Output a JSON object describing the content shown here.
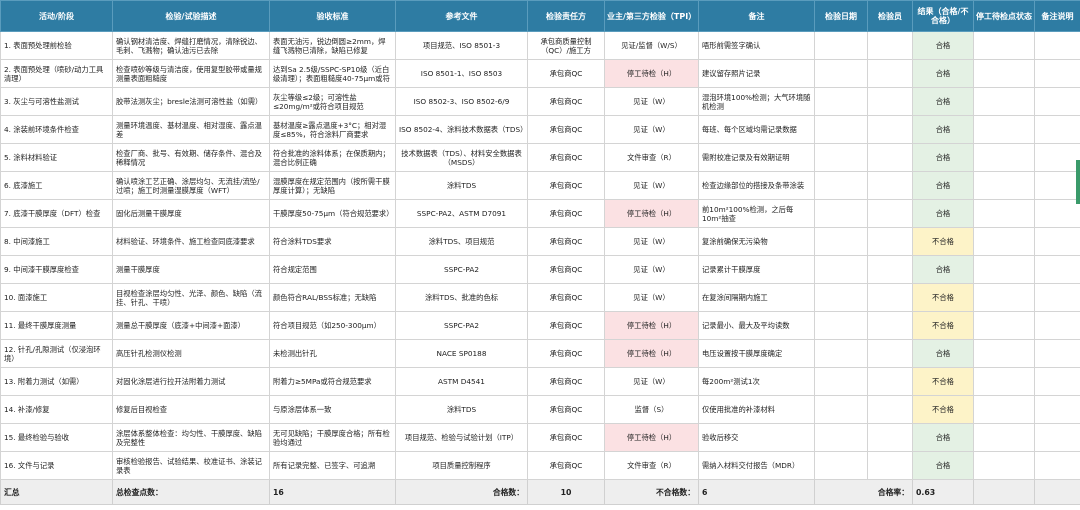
{
  "headers": [
    "活动/阶段",
    "检验/试验描述",
    "验收标准",
    "参考文件",
    "检验责任方",
    "业主/第三方检验（TPI）",
    "备注",
    "检验日期",
    "检验员",
    "结果（合格/不合格）",
    "停工待检点状态",
    "备注说明"
  ],
  "rows": [
    {
      "activity": "1. 表面预处理前检验",
      "desc": "确认钢材清洁度、焊缝打磨情况，清除锐边、毛刺、飞溅物；确认油污已去除",
      "criteria": "表面无油污，锐边倒圆≥2mm，焊缝飞溅物已清除，缺陷已修复",
      "ref": "项目规范、ISO 8501-3",
      "resp": "承包商质量控制（QC）/施工方",
      "tpi": "见证/监督（W/S）",
      "tpi_stop": false,
      "note": "唔形前需签字确认",
      "result": "合格",
      "pass": true
    },
    {
      "activity": "2. 表面预处理（喷砂/动力工具清理）",
      "desc": "检查喷砂等级与清洁度，使用复型胶带或量规测量表面粗糙度",
      "criteria": "达到Sa 2.5级/SSPC-SP10级（近白级清理）；表面粗糙度40-75μm或符合规范要求",
      "ref": "ISO 8501-1、ISO 8503",
      "resp": "承包商QC",
      "tpi": "停工待检（H）",
      "tpi_stop": true,
      "note": "建议留存照片记录",
      "result": "合格",
      "pass": true
    },
    {
      "activity": "3. 灰尘与可溶性盐测试",
      "desc": "胶带法测灰尘；bresle法测可溶性盐（如需）",
      "criteria": "灰尘等级≤2级；可溶性盐≤20mg/m²或符合项目规范",
      "ref": "ISO 8502-3、ISO 8502-6/9",
      "resp": "承包商QC",
      "tpi": "见证（W）",
      "tpi_stop": false,
      "note": "湿泡环境100%检测；大气环境随机检测",
      "result": "合格",
      "pass": true
    },
    {
      "activity": "4. 涂装前环境条件检查",
      "desc": "测量环境温度、基材温度、相对湿度、露点温差",
      "criteria": "基材温度≥露点温度+3°C；相对湿度≤85%，符合涂料厂商要求",
      "ref": "ISO 8502-4、涂料技术数据表（TDS）",
      "resp": "承包商QC",
      "tpi": "见证（W）",
      "tpi_stop": false,
      "note": "每班、每个区域均需记录数据",
      "result": "合格",
      "pass": true
    },
    {
      "activity": "5. 涂料材料验证",
      "desc": "检查厂商、批号、有效期、储存条件、混合及稀释情况",
      "criteria": "符合批准的涂料体系；在保质期内；混合比例正确",
      "ref": "技术数据表（TDS）、材料安全数据表（MSDS）",
      "resp": "承包商QC",
      "tpi": "文件审查（R）",
      "tpi_stop": false,
      "note": "需附校准记录及有效期证明",
      "result": "合格",
      "pass": true
    },
    {
      "activity": "6. 底漆施工",
      "desc": "确认喷涂工艺正确、涂层均匀、无流挂/流坠/过喷；施工时测量湿膜厚度（WFT）",
      "criteria": "湿膜厚度在规定范围内（按所需干膜厚度计算）；无缺陷",
      "ref": "涂料TDS",
      "resp": "承包商QC",
      "tpi": "见证（W）",
      "tpi_stop": false,
      "note": "检查边缘部位的搭接及条带涂装",
      "result": "合格",
      "pass": true
    },
    {
      "activity": "7. 底漆干膜厚度（DFT）检查",
      "desc": "固化后测量干膜厚度",
      "criteria": "干膜厚度50-75μm（符合规范要求）",
      "ref": "SSPC-PA2、ASTM D7091",
      "resp": "承包商QC",
      "tpi": "停工待检（H）",
      "tpi_stop": true,
      "note": "前10m²100%检测，之后每10m²抽查",
      "result": "合格",
      "pass": true
    },
    {
      "activity": "8. 中间漆施工",
      "desc": "材料验证、环境条件、施工检查同底漆要求",
      "criteria": "符合涂料TDS要求",
      "ref": "涂料TDS、项目规范",
      "resp": "承包商QC",
      "tpi": "见证（W）",
      "tpi_stop": false,
      "note": "复涂前确保无污染物",
      "result": "不合格",
      "pass": false
    },
    {
      "activity": "9. 中间漆干膜厚度检查",
      "desc": "测量干膜厚度",
      "criteria": "符合规定范围",
      "ref": "SSPC-PA2",
      "resp": "承包商QC",
      "tpi": "见证（W）",
      "tpi_stop": false,
      "note": "记录累计干膜厚度",
      "result": "合格",
      "pass": true
    },
    {
      "activity": "10. 面漆施工",
      "desc": "目视检查涂层均匀性、光泽、颜色、缺陷（流挂、针孔、干喷）",
      "criteria": "颜色符合RAL/BSS标准；无缺陷",
      "ref": "涂料TDS、批准的色标",
      "resp": "承包商QC",
      "tpi": "见证（W）",
      "tpi_stop": false,
      "note": "在复涂间隔期内施工",
      "result": "不合格",
      "pass": false
    },
    {
      "activity": "11. 最终干膜厚度测量",
      "desc": "测量总干膜厚度（底漆+中间漆+面漆）",
      "criteria": "符合项目规范（如250-300μm）",
      "ref": "SSPC-PA2",
      "resp": "承包商QC",
      "tpi": "停工待检（H）",
      "tpi_stop": true,
      "note": "记录最小、最大及平均读数",
      "result": "不合格",
      "pass": false
    },
    {
      "activity": "12. 针孔/孔隙测试（仅浸泡环境）",
      "desc": "高压针孔检测仪检测",
      "criteria": "未检测出针孔",
      "ref": "NACE SP0188",
      "resp": "承包商QC",
      "tpi": "停工待检（H）",
      "tpi_stop": true,
      "note": "电压设置按干膜厚度确定",
      "result": "合格",
      "pass": true
    },
    {
      "activity": "13. 附着力测试（如需）",
      "desc": "对固化涂层进行拉开法附着力测试",
      "criteria": "附着力≥5MPa或符合规范要求",
      "ref": "ASTM D4541",
      "resp": "承包商QC",
      "tpi": "见证（W）",
      "tpi_stop": false,
      "note": "每200m²测试1次",
      "result": "不合格",
      "pass": false
    },
    {
      "activity": "14. 补漆/修复",
      "desc": "修复后目视检查",
      "criteria": "与原涂层体系一致",
      "ref": "涂料TDS",
      "resp": "承包商QC",
      "tpi": "监督（S）",
      "tpi_stop": false,
      "note": "仅使用批准的补漆材料",
      "result": "不合格",
      "pass": false
    },
    {
      "activity": "15. 最终检验与验收",
      "desc": "涂层体系整体检查：均匀性、干膜厚度、缺陷及完整性",
      "criteria": "无可见缺陷；干膜厚度合格；所有检验均通过",
      "ref": "项目规范、检验与试验计划（ITP）",
      "resp": "承包商QC",
      "tpi": "停工待检（H）",
      "tpi_stop": true,
      "note": "验收后移交",
      "result": "合格",
      "pass": true
    },
    {
      "activity": "16. 文件与记录",
      "desc": "审核检验报告、试验结果、校准证书、涂装记录表",
      "criteria": "所有记录完整、已签字、可追溯",
      "ref": "项目质量控制程序",
      "resp": "承包商QC",
      "tpi": "文件审查（R）",
      "tpi_stop": false,
      "note": "需纳入材料交付报告（MDR）",
      "result": "合格",
      "pass": true
    }
  ],
  "summary": {
    "label": "汇总",
    "total_label": "总检查点数：",
    "total_value": "16",
    "pass_label": "合格数：",
    "pass_value": "10",
    "fail_label": "不合格数：",
    "fail_value": "6",
    "rate_label": "合格率：",
    "rate_value": "0.63"
  },
  "colors": {
    "header_bg": "#2e7ca3",
    "pass_bg": "#e4f1e4",
    "fail_bg": "#fdf3c8",
    "hold_bg": "#fbe1e3"
  }
}
